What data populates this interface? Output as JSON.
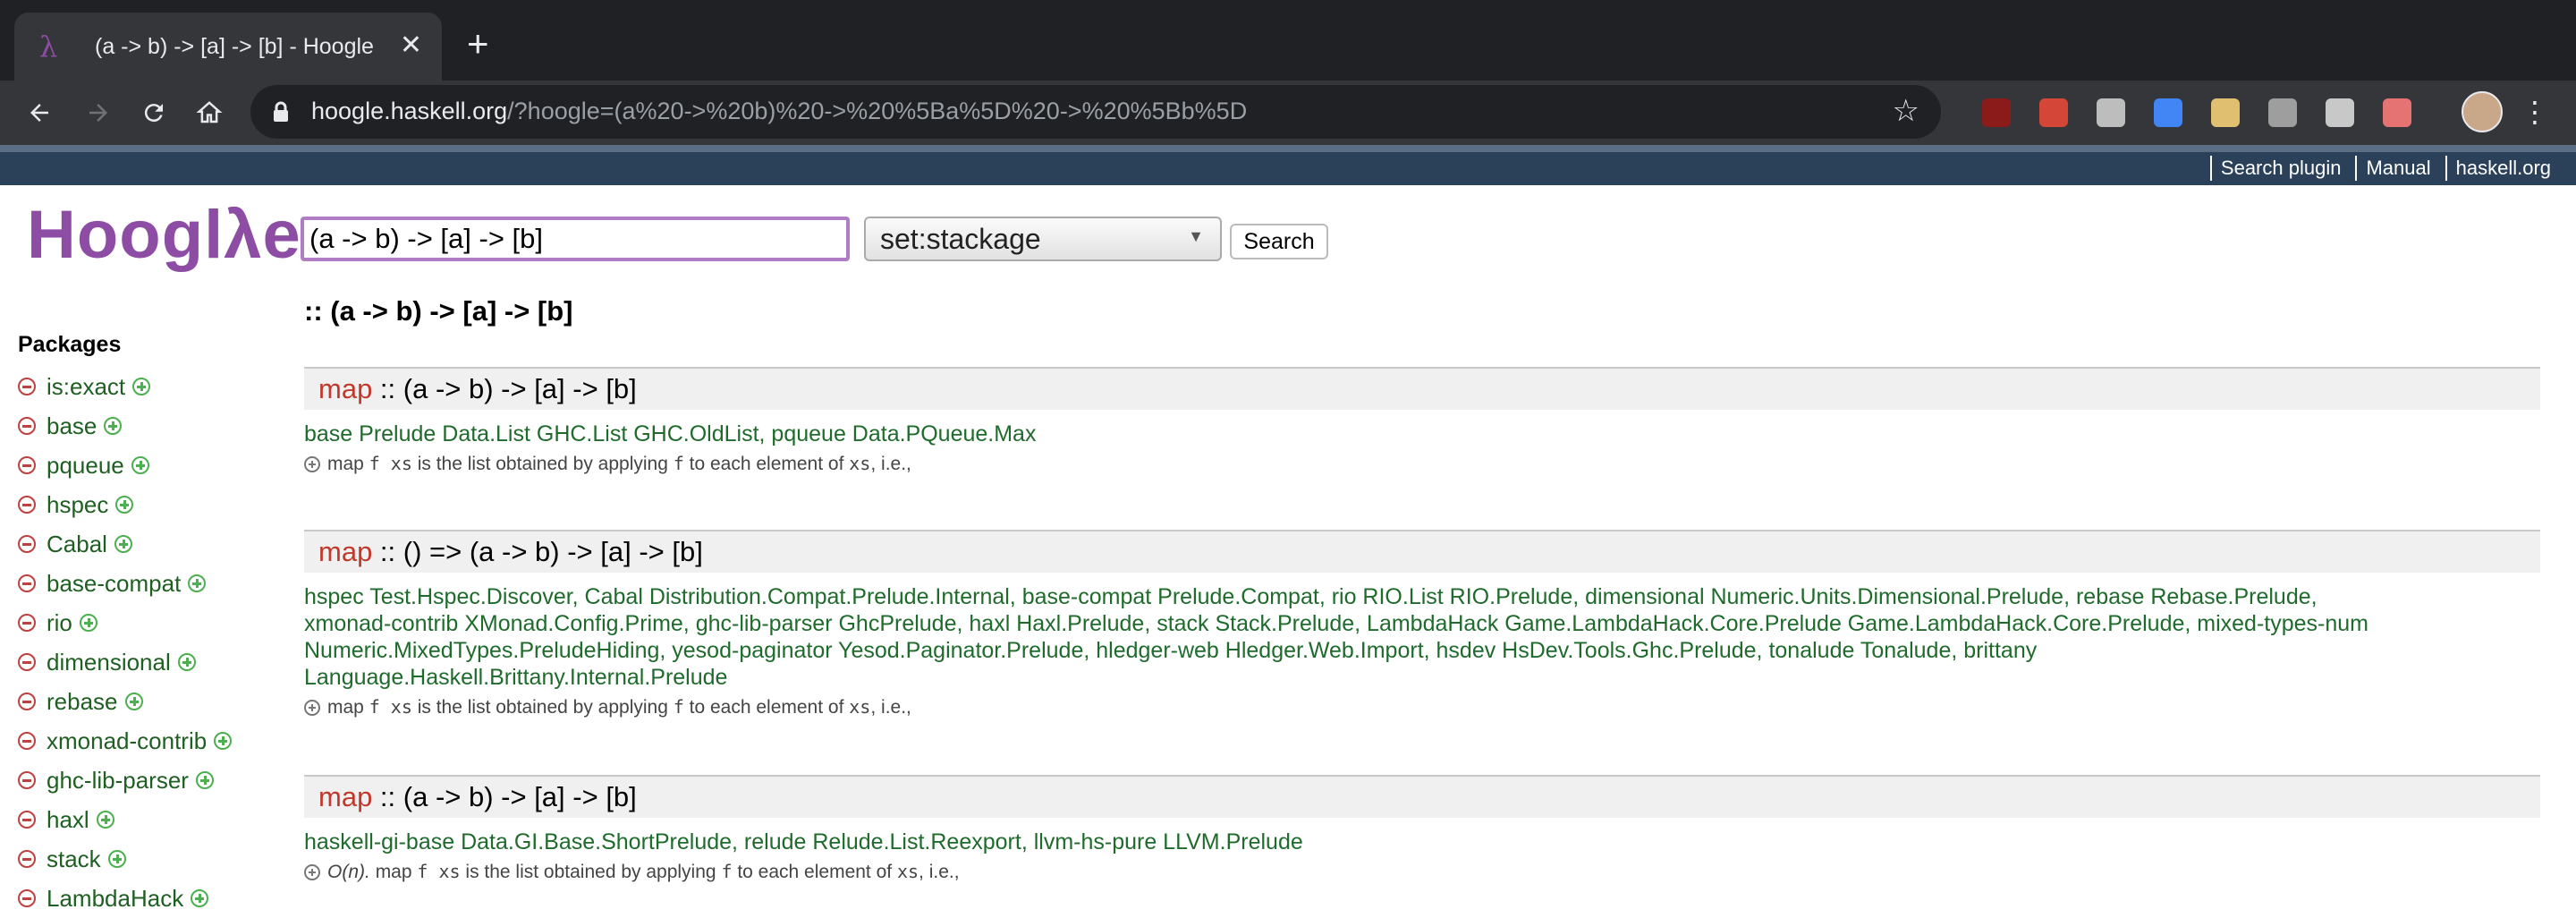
{
  "browser": {
    "tab_title": "(a -> b) -> [a] -> [b] - Hoogle",
    "tab_favicon": "λ",
    "tab_close": "✕",
    "new_tab": "+",
    "url_host": "hoogle.haskell.org",
    "url_rest": "/?hoogle=(a%20->%20b)%20->%20%5Ba%5D%20->%20%5Bb%5D",
    "star": "☆",
    "menu": "⋮",
    "icons": [
      "back-arrow-icon",
      "forward-arrow-icon",
      "reload-icon",
      "home-icon",
      "lock-icon",
      "star-icon"
    ],
    "extensions": [
      {
        "name": "ublock-extension-icon",
        "color": "#8b1a1a"
      },
      {
        "name": "pdf-extension-icon",
        "color": "#d44638"
      },
      {
        "name": "document-extension-icon",
        "color": "#bdbdbd"
      },
      {
        "name": "shield-extension-icon",
        "color": "#4285f4"
      },
      {
        "name": "glasses-extension-icon",
        "color": "#e0c070"
      },
      {
        "name": "k-extension-icon",
        "color": "#9e9e9e"
      },
      {
        "name": "image-extension-icon",
        "color": "#c8c8c8"
      },
      {
        "name": "window-extension-icon",
        "color": "#e57373"
      }
    ]
  },
  "hoogle": {
    "top_links": [
      "Search plugin",
      "Manual",
      "haskell.org"
    ],
    "logo": "Hooglλe",
    "search_value": "(a -> b) -> [a] -> [b]",
    "scope": "set:stackage",
    "search_button": "Search",
    "query_heading": ":: (a -> b) -> [a] -> [b]"
  },
  "sidebar": {
    "heading": "Packages",
    "packages": [
      "is:exact",
      "base",
      "pqueue",
      "hspec",
      "Cabal",
      "base-compat",
      "rio",
      "dimensional",
      "rebase",
      "xmonad-contrib",
      "ghc-lib-parser",
      "haxl",
      "stack",
      "LambdaHack"
    ]
  },
  "results": [
    {
      "name": "map",
      "signature": " :: (a -> b) -> [a] -> [b]",
      "modules_line1": "base Prelude Data.List GHC.List GHC.OldList, pqueue Data.PQueue.Max",
      "modules_line2": "",
      "modules_line3": "",
      "modules_line4": "",
      "doc_prefix": "",
      "doc_pre": "map",
      "doc_code1": "f xs",
      "doc_mid": "is the list obtained by applying",
      "doc_code2": "f",
      "doc_post": "to each element of",
      "doc_code3": "xs",
      "doc_tail": ", i.e.,"
    },
    {
      "name": "map",
      "signature": " :: () => (a -> b) -> [a] -> [b]",
      "modules_line1": "hspec Test.Hspec.Discover, Cabal Distribution.Compat.Prelude.Internal, base-compat Prelude.Compat, rio RIO.List RIO.Prelude, dimensional Numeric.Units.Dimensional.Prelude, rebase Rebase.Prelude,",
      "modules_line2": "xmonad-contrib XMonad.Config.Prime, ghc-lib-parser GhcPrelude, haxl Haxl.Prelude, stack Stack.Prelude, LambdaHack Game.LambdaHack.Core.Prelude Game.LambdaHack.Core.Prelude, mixed-types-num",
      "modules_line3": "Numeric.MixedTypes.PreludeHiding, yesod-paginator Yesod.Paginator.Prelude, hledger-web Hledger.Web.Import, hsdev HsDev.Tools.Ghc.Prelude, tonalude Tonalude, brittany",
      "modules_line4": "Language.Haskell.Brittany.Internal.Prelude",
      "doc_prefix": "",
      "doc_pre": "map",
      "doc_code1": "f xs",
      "doc_mid": "is the list obtained by applying",
      "doc_code2": "f",
      "doc_post": "to each element of",
      "doc_code3": "xs",
      "doc_tail": ", i.e.,"
    },
    {
      "name": "map",
      "signature": " :: (a -> b) -> [a] -> [b]",
      "modules_line1": "haskell-gi-base Data.GI.Base.ShortPrelude, relude Relude.List.Reexport, llvm-hs-pure LLVM.Prelude",
      "modules_line2": "",
      "modules_line3": "",
      "modules_line4": "",
      "doc_prefix": "O(n).",
      "doc_pre": "map",
      "doc_code1": "f xs",
      "doc_mid": "is the list obtained by applying",
      "doc_code2": "f",
      "doc_post": "to each element of",
      "doc_code3": "xs",
      "doc_tail": ", i.e.,"
    }
  ]
}
